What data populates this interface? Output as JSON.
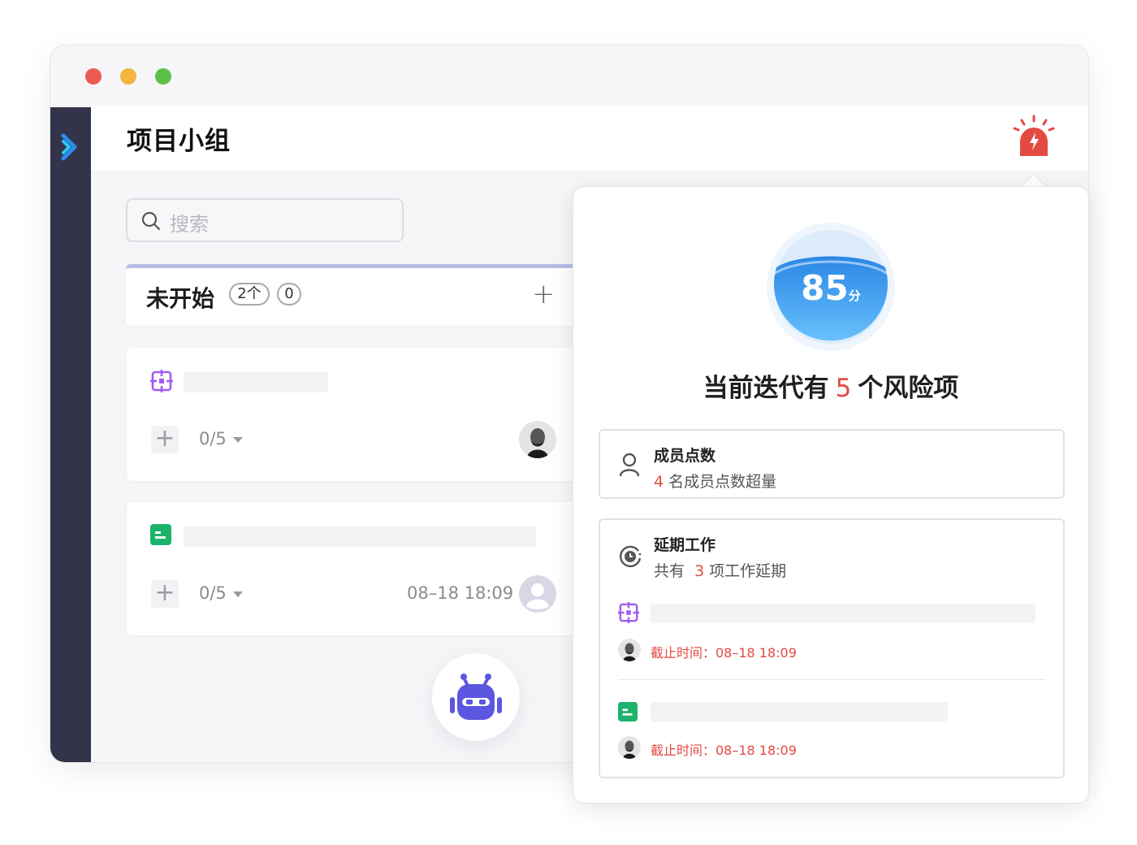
{
  "window": {
    "controls": [
      "close",
      "minimize",
      "maximize"
    ]
  },
  "header": {
    "title": "项目小组",
    "alarm_icon": "alarm-icon"
  },
  "search": {
    "placeholder": "搜索"
  },
  "column": {
    "title": "未开始",
    "count_badge": "2个",
    "second_badge": "0",
    "add_label": "+"
  },
  "cards": [
    {
      "type": "story",
      "progress": "0/5",
      "date": "",
      "assignee": "photo"
    },
    {
      "type": "task",
      "progress": "0/5",
      "date": "08–18 18:09",
      "assignee": "placeholder"
    }
  ],
  "panel": {
    "score": "85",
    "score_unit": "分",
    "risk_prefix": "当前迭代有",
    "risk_count": "5",
    "risk_suffix": "个风险项",
    "member_points": {
      "title": "成员点数",
      "count": "4",
      "desc": "名成员点数超量"
    },
    "delayed_work": {
      "title": "延期工作",
      "prefix": "共有",
      "count": "3",
      "suffix": "项工作延期",
      "items": [
        {
          "type": "story",
          "deadline": "截止时间：08–18 18:09"
        },
        {
          "type": "task",
          "deadline": "截止时间：08–18 18:09"
        }
      ]
    }
  },
  "colors": {
    "accent": "#1f9bf0",
    "danger": "#e34a42",
    "sidebar": "#333449",
    "story": "#a05cf2",
    "task": "#1db36a",
    "robot": "#5b57e0"
  }
}
